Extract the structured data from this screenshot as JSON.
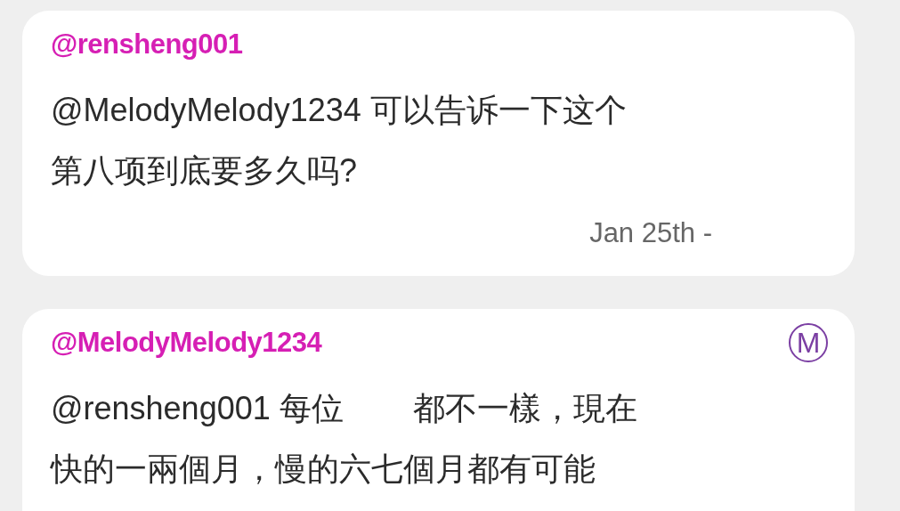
{
  "comments": [
    {
      "author": "@rensheng001",
      "lines": [
        [
          "@MelodyMelody1234 可以告诉一下这个"
        ],
        [
          "第八项到底要多久吗?"
        ]
      ],
      "date": "Jan 25th -"
    },
    {
      "author": "@MelodyMelody1234",
      "badge": "M",
      "lines": [
        [
          "@rensheng001 每位",
          "都不一樣，現在"
        ],
        [
          "快的一兩個月，慢的六七個月都有可能"
        ]
      ]
    }
  ]
}
